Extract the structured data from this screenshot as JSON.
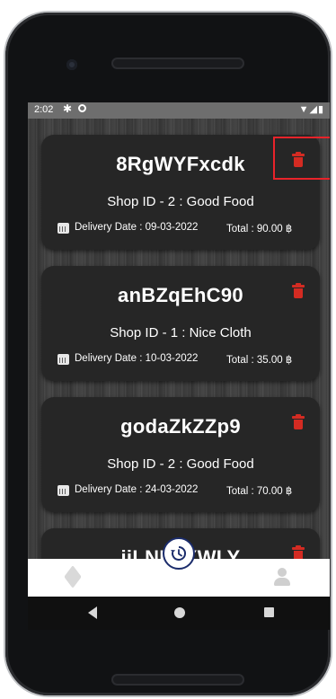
{
  "statusbar": {
    "time": "2:02",
    "icons": [
      "gear-icon",
      "circle-icon",
      "wifi-icon",
      "signal-icon",
      "battery-icon"
    ]
  },
  "orders": [
    {
      "order_id": "8RgWYFxcdk",
      "shop": "Shop ID - 2 : Good Food",
      "delivery": "Delivery Date : 09-03-2022",
      "total": "Total : 90.00 ฿"
    },
    {
      "order_id": "anBZqEhC90",
      "shop": "Shop ID - 1 : Nice Cloth",
      "delivery": "Delivery Date : 10-03-2022",
      "total": "Total : 35.00 ฿"
    },
    {
      "order_id": "godaZkZZp9",
      "shop": "Shop ID - 2 : Good Food",
      "delivery": "Delivery Date : 24-03-2022",
      "total": "Total : 70.00 ฿"
    },
    {
      "order_id": "jiLNFqXWLY",
      "shop": "",
      "delivery": "",
      "total": ""
    }
  ],
  "colors": {
    "accent_red": "#d42b22",
    "nav_blue": "#1b2c6b",
    "card_bg": "#262626"
  },
  "bottom_nav": {
    "left_icon": "box-icon",
    "center_icon": "history-icon",
    "right_icon": "user-icon"
  }
}
